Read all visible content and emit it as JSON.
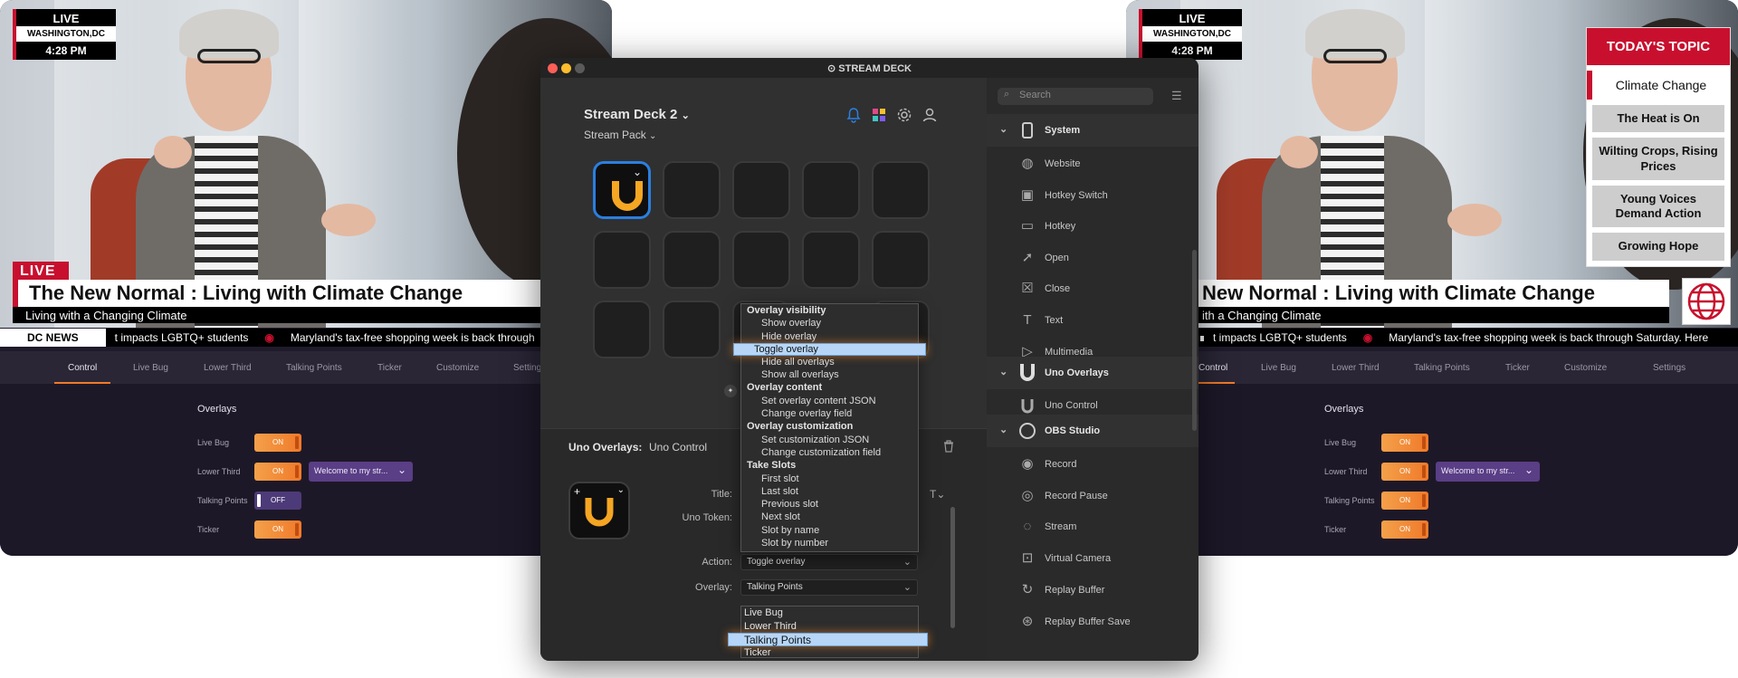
{
  "broadcast": {
    "live_small": "LIVE",
    "location": "WASHINGTON,DC",
    "time": "4:28 PM",
    "live_tag": "LIVE",
    "headline": "The New Normal : Living with Climate Change",
    "subheadline": "Living with a Changing Climate",
    "ticker_label": "DC NEWS",
    "ticker_item_1": "t impacts LGBTQ+ students",
    "ticker_item_2": "Maryland's tax-free shopping week is back through",
    "ticker_item_2_full": "Maryland's tax-free shopping week is back through Saturday. Here",
    "headline_right": "New Normal : Living with Climate Change",
    "subheadline_right": "ith a Changing Climate"
  },
  "control_tabs": [
    "Control",
    "Live Bug",
    "Lower Third",
    "Talking Points",
    "Ticker",
    "Customize",
    "Settings"
  ],
  "control_tabs_left_last": "Setting",
  "overlays": {
    "title": "Overlays",
    "rows": [
      {
        "label": "Live Bug",
        "state": "ON"
      },
      {
        "label": "Lower Third",
        "state": "ON",
        "select": "Welcome to my str..."
      },
      {
        "label": "Talking Points",
        "state": "OFF"
      },
      {
        "label": "Ticker",
        "state": "ON"
      }
    ],
    "rows_right_talking_state": "ON"
  },
  "topics": {
    "header": "TODAY'S TOPIC",
    "current": "Climate Change",
    "items": [
      "The Heat is On",
      "Wilting Crops, Rising Prices",
      "Young Voices Demand Action",
      "Growing Hope"
    ]
  },
  "streamdeck": {
    "window_title": "STREAM DECK",
    "device": "Stream Deck 2",
    "profile": "Stream Pack",
    "props_title": "Uno Overlays:",
    "props_subtitle": "Uno Control",
    "title_label": "Title:",
    "token_label": "Uno Token:",
    "action_label": "Action:",
    "action_value": "Toggle overlay",
    "overlay_label": "Overlay:",
    "overlay_value": "Talking Points",
    "menu": [
      {
        "type": "h",
        "text": "Overlay visibility"
      },
      {
        "type": "i",
        "text": "Show overlay"
      },
      {
        "type": "i",
        "text": "Hide overlay"
      },
      {
        "type": "hl",
        "text": "Toggle overlay"
      },
      {
        "type": "i",
        "text": "Hide all overlays"
      },
      {
        "type": "i",
        "text": "Show all overlays"
      },
      {
        "type": "h",
        "text": "Overlay content"
      },
      {
        "type": "i",
        "text": "Set overlay content JSON"
      },
      {
        "type": "i",
        "text": "Change overlay field"
      },
      {
        "type": "h",
        "text": "Overlay customization"
      },
      {
        "type": "i",
        "text": "Set customization JSON"
      },
      {
        "type": "i",
        "text": "Change customization field"
      },
      {
        "type": "h",
        "text": "Take Slots"
      },
      {
        "type": "i",
        "text": "First slot"
      },
      {
        "type": "i",
        "text": "Last slot"
      },
      {
        "type": "i",
        "text": "Previous slot"
      },
      {
        "type": "i",
        "text": "Next slot"
      },
      {
        "type": "i",
        "text": "Slot by name"
      },
      {
        "type": "i",
        "text": "Slot by number"
      }
    ],
    "overlay_list": [
      "Live Bug",
      "Lower Third",
      "Talking Points",
      "Ticker"
    ],
    "search_placeholder": "Search",
    "sidebar": {
      "system": "System",
      "system_items": [
        "Website",
        "Hotkey Switch",
        "Hotkey",
        "Open",
        "Close",
        "Text",
        "Multimedia"
      ],
      "uno": "Uno Overlays",
      "uno_items": [
        "Uno Control"
      ],
      "obs": "OBS Studio",
      "obs_items": [
        "Record",
        "Record Pause",
        "Stream",
        "Virtual Camera",
        "Replay Buffer",
        "Replay Buffer Save"
      ]
    }
  },
  "colors": {
    "accent_red": "#c8102e",
    "orange": "#f07a2a",
    "select_blue": "#2a7fe0",
    "purple": "#5a3e86"
  }
}
